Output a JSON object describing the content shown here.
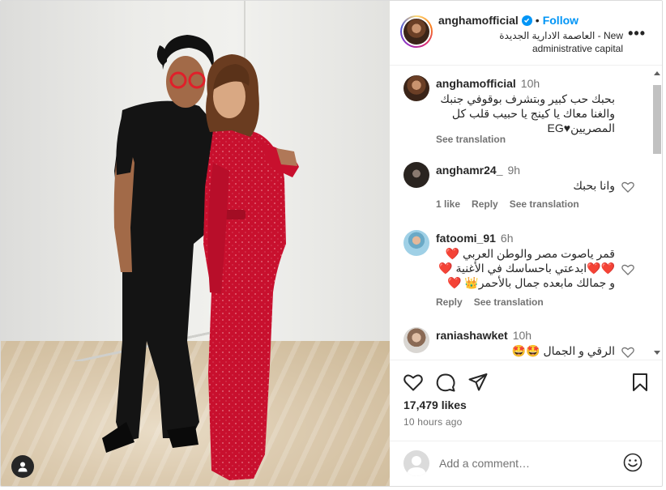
{
  "post": {
    "username": "anghamofficial",
    "follow_label": "Follow",
    "separator": "•",
    "location_line1": "العاصمة الادارية الجديدة - New",
    "location_line2": "administrative capital",
    "more_label": "•••"
  },
  "comments": [
    {
      "username": "anghamofficial",
      "time": "10h",
      "lines": [
        "بحبك حب كبير وبتشرف بوقوفي جنبك",
        "والغنا معاك يا كينج يا حبيب قلب كل",
        "المصريين♥EG"
      ],
      "see_translation": "See translation"
    },
    {
      "username": "anghamr24_",
      "time": "9h",
      "lines": [
        "وانا بحبك"
      ],
      "likes": "1 like",
      "reply": "Reply",
      "see_translation": "See translation"
    },
    {
      "username": "fatoomi_91",
      "time": "6h",
      "lines": [
        "قمر ياصوت مصر والوطن العربي ❤️",
        "❤️❤️ابدعتي باحساسك في الأغنية ❤️",
        "و جمالك مابعده جمال بالأحمر👑 ❤️"
      ],
      "reply": "Reply",
      "see_translation": "See translation"
    },
    {
      "username": "raniashawket",
      "time": "10h",
      "lines": [
        "الرقي و الجمال 🤩🤩"
      ]
    }
  ],
  "actions": {
    "like_icon": "heart-icon",
    "comment_icon": "comment-icon",
    "share_icon": "share-icon",
    "save_icon": "bookmark-icon",
    "likes_count": "17,479 likes",
    "posted_ago": "10 hours ago"
  },
  "add_comment": {
    "placeholder": "Add a comment…",
    "emoji_icon": "emoji-icon"
  },
  "colors": {
    "accent_blue": "#0095f6",
    "text_primary": "#262626",
    "text_secondary": "#737373",
    "dress_red": "#c8102e"
  }
}
